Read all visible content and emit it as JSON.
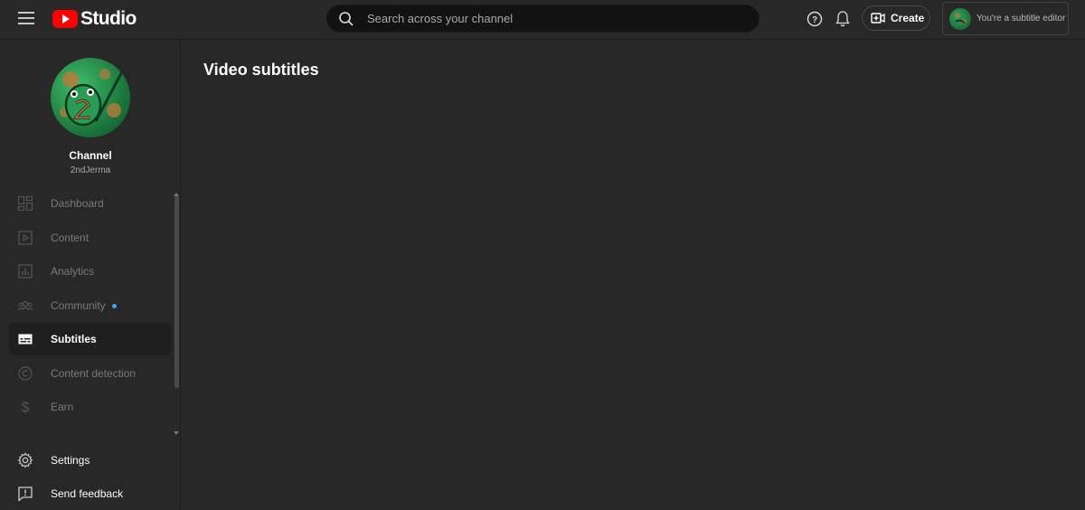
{
  "header": {
    "logo_text": "Studio",
    "search_placeholder": "Search across your channel",
    "create_label": "Create",
    "editor_label": "You're a subtitle editor"
  },
  "channel": {
    "title": "Channel",
    "handle": "2ndJerma"
  },
  "sidebar": {
    "items": [
      {
        "label": "Dashboard",
        "icon": "dashboard-icon"
      },
      {
        "label": "Content",
        "icon": "content-icon"
      },
      {
        "label": "Analytics",
        "icon": "analytics-icon"
      },
      {
        "label": "Community",
        "icon": "community-icon"
      },
      {
        "label": "Subtitles",
        "icon": "subtitles-icon"
      },
      {
        "label": "Content detection",
        "icon": "copyright-icon"
      },
      {
        "label": "Earn",
        "icon": "dollar-icon"
      }
    ],
    "footer": [
      {
        "label": "Settings",
        "icon": "gear-icon"
      },
      {
        "label": "Send feedback",
        "icon": "feedback-icon"
      }
    ]
  },
  "main": {
    "title": "Video subtitles"
  },
  "colors": {
    "accent_red": "#ff0000",
    "notification_dot": "#3ea6ff",
    "background": "#282828"
  }
}
